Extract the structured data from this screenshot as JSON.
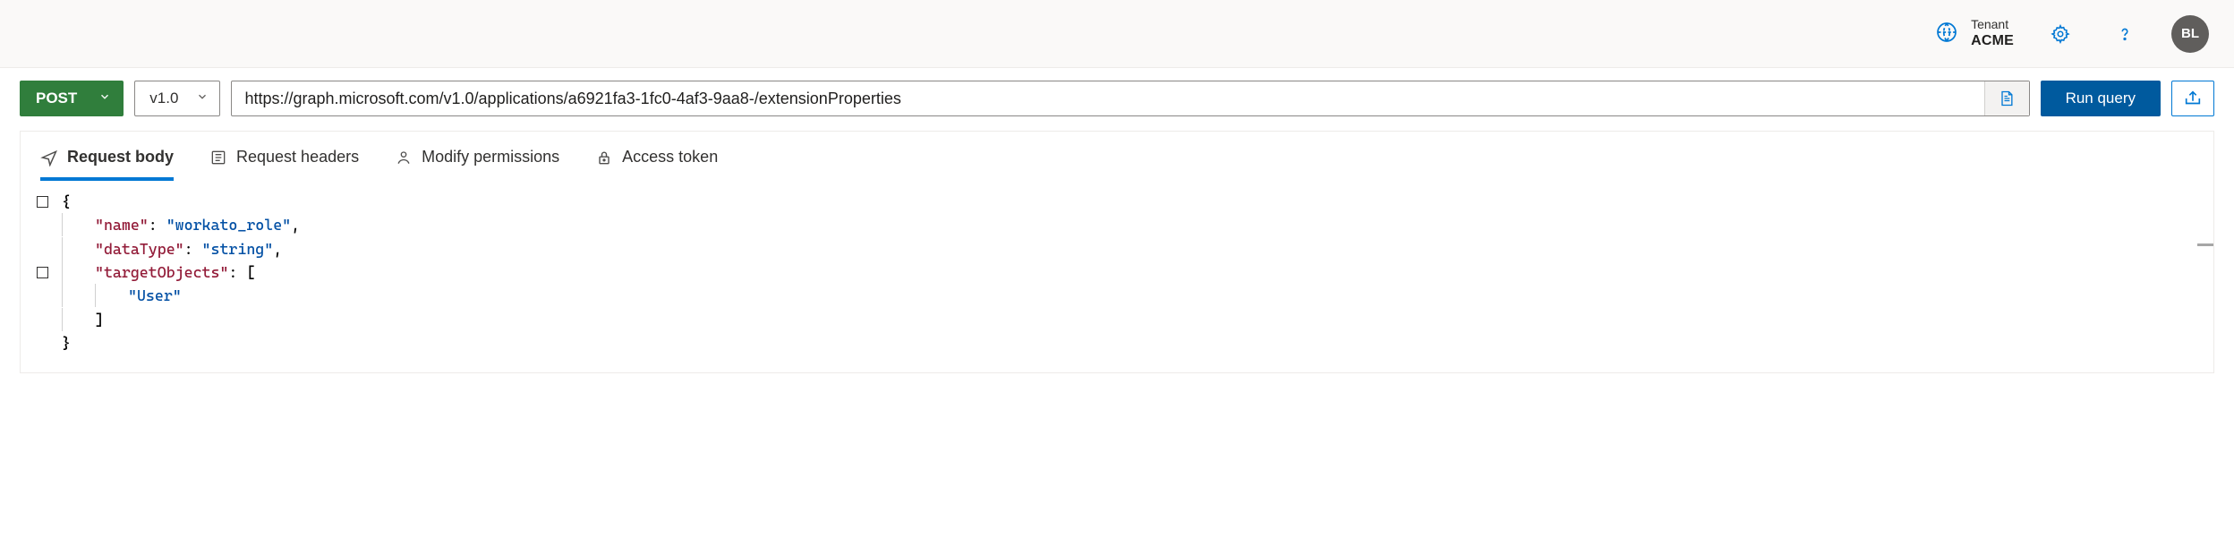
{
  "header": {
    "tenant_label": "Tenant",
    "tenant_name": "ACME",
    "avatar_initials": "BL"
  },
  "query": {
    "method": "POST",
    "version": "v1.0",
    "url_prefix": "https://graph.microsoft.com/v1.0/applications/a6921fa3-1fc0-4af3-9aa8-",
    "url_redacted": "",
    "url_suffix": "/extensionProperties",
    "run_label": "Run query"
  },
  "tabs": {
    "request_body": "Request body",
    "request_headers": "Request headers",
    "modify_permissions": "Modify permissions",
    "access_token": "Access token",
    "selected": "request_body"
  },
  "body_json": {
    "name": "workato_role",
    "dataType": "string",
    "targetObjects": [
      "User"
    ]
  },
  "code_lines": [
    {
      "gutter": true,
      "indent": 0,
      "tokens": [
        {
          "cls": "tk-brace",
          "t": "{"
        }
      ]
    },
    {
      "gutter": false,
      "indent": 1,
      "tokens": [
        {
          "cls": "tk-key",
          "t": "\"name\""
        },
        {
          "cls": "tk-punct",
          "t": ": "
        },
        {
          "cls": "tk-str",
          "t": "\"workato_role\""
        },
        {
          "cls": "tk-punct",
          "t": ","
        }
      ]
    },
    {
      "gutter": false,
      "indent": 1,
      "tokens": [
        {
          "cls": "tk-key",
          "t": "\"dataType\""
        },
        {
          "cls": "tk-punct",
          "t": ": "
        },
        {
          "cls": "tk-str",
          "t": "\"string\""
        },
        {
          "cls": "tk-punct",
          "t": ","
        }
      ]
    },
    {
      "gutter": true,
      "indent": 1,
      "tokens": [
        {
          "cls": "tk-key",
          "t": "\"targetObjects\""
        },
        {
          "cls": "tk-punct",
          "t": ": ["
        }
      ]
    },
    {
      "gutter": false,
      "indent": 2,
      "tokens": [
        {
          "cls": "tk-str",
          "t": "\"User\""
        }
      ]
    },
    {
      "gutter": false,
      "indent": 1,
      "tokens": [
        {
          "cls": "tk-punct",
          "t": "]"
        }
      ]
    },
    {
      "gutter": false,
      "indent": 0,
      "tokens": [
        {
          "cls": "tk-brace",
          "t": "}"
        }
      ]
    }
  ]
}
